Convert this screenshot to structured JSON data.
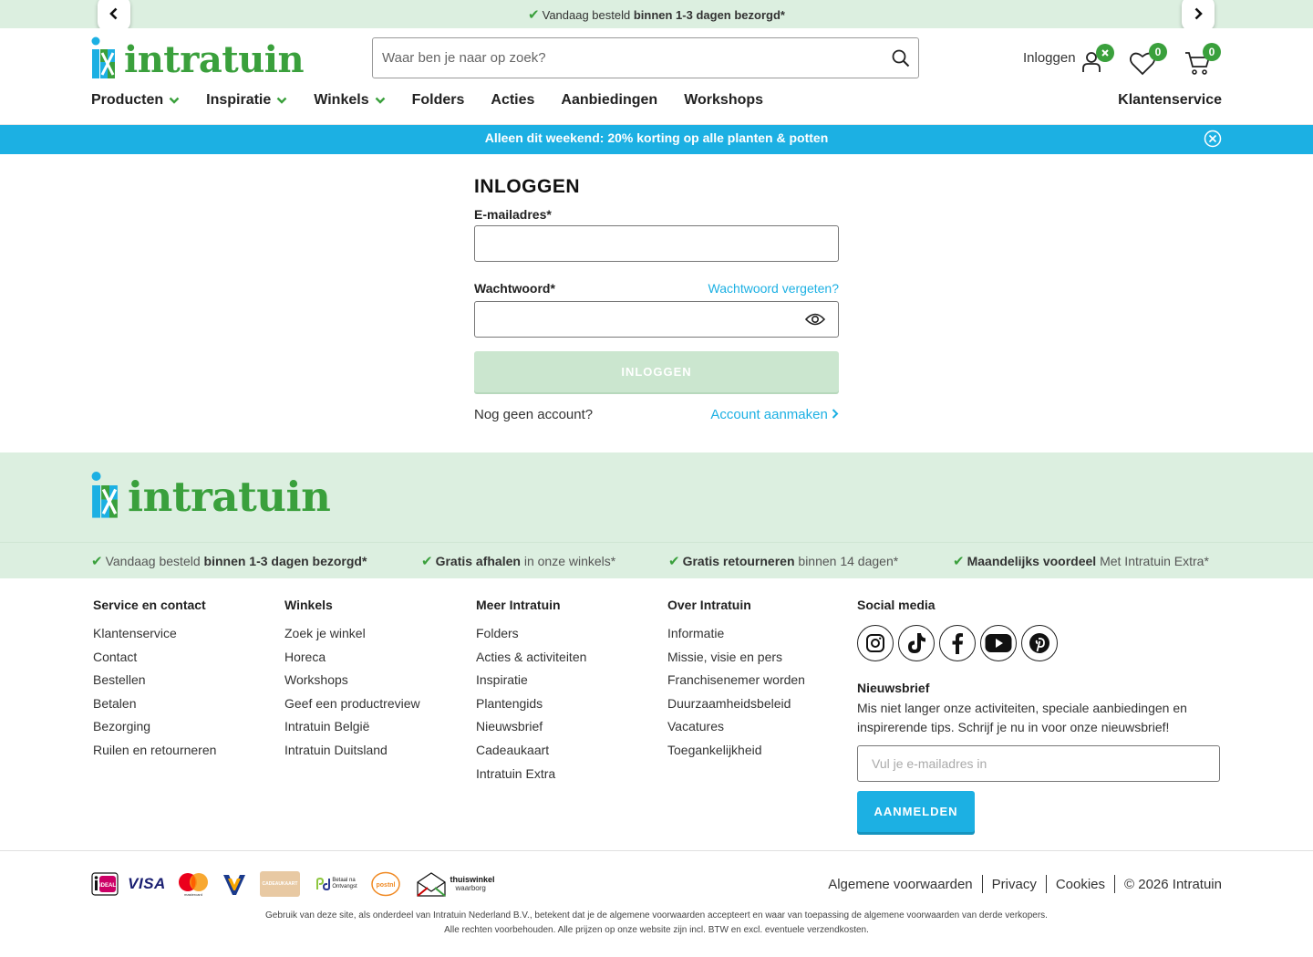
{
  "topbar": {
    "msg_pre": "Vandaag besteld ",
    "msg_bold": "binnen 1-3 dagen bezorgd*"
  },
  "header": {
    "logo_text": "intratuin",
    "search_placeholder": "Waar ben je naar op zoek?",
    "login_label": "Inloggen",
    "wishlist_count": "0",
    "cart_count": "0"
  },
  "nav": {
    "items": [
      "Producten",
      "Inspiratie",
      "Winkels",
      "Folders",
      "Acties",
      "Aanbiedingen",
      "Workshops"
    ],
    "right": "Klantenservice"
  },
  "promo": {
    "text": "Alleen dit weekend: 20% korting op alle planten & potten"
  },
  "login": {
    "title": "INLOGGEN",
    "email_label": "E-mailadres*",
    "password_label": "Wachtwoord*",
    "forgot_link": "Wachtwoord vergeten?",
    "submit": "INLOGGEN",
    "no_account": "Nog geen account?",
    "create_account": "Account aanmaken"
  },
  "footer": {
    "logo_text": "intratuin",
    "usps": [
      {
        "bold": "binnen 1-3 dagen bezorgd*",
        "pre": "Vandaag besteld ",
        "post": ""
      },
      {
        "bold": "Gratis afhalen",
        "pre": "",
        "post": " in onze winkels*"
      },
      {
        "bold": "Gratis retourneren",
        "pre": "",
        "post": " binnen 14 dagen*"
      },
      {
        "bold": "Maandelijks voordeel",
        "pre": "",
        "post": " Met Intratuin Extra*"
      }
    ],
    "columns": [
      {
        "title": "Service en contact",
        "links": [
          "Klantenservice",
          "Contact",
          "Bestellen",
          "Betalen",
          "Bezorging",
          "Ruilen en retourneren"
        ]
      },
      {
        "title": "Winkels",
        "links": [
          "Zoek je winkel",
          "Horeca",
          "Workshops",
          "Geef een productreview",
          "Intratuin België",
          "Intratuin Duitsland"
        ]
      },
      {
        "title": "Meer Intratuin",
        "links": [
          "Folders",
          "Acties & activiteiten",
          "Inspiratie",
          "Plantengids",
          "Nieuwsbrief",
          "Cadeaukaart",
          "Intratuin Extra"
        ]
      },
      {
        "title": "Over Intratuin",
        "links": [
          "Informatie",
          "Missie, visie en pers",
          "Franchisenemer worden",
          "Duurzaamheidsbeleid",
          "Vacatures",
          "Toegankelijkheid"
        ]
      }
    ],
    "social_title": "Social media",
    "social": [
      "instagram-icon",
      "tiktok-icon",
      "facebook-icon",
      "youtube-icon",
      "pinterest-icon"
    ],
    "newsletter_title": "Nieuwsbrief",
    "newsletter_text": "Mis niet langer onze activiteiten, speciale aanbiedingen en inspirerende tips. Schrijf je nu in voor onze nieuwsbrief!",
    "newsletter_placeholder": "Vul je e-mailadres in",
    "newsletter_button": "AANMELDEN",
    "payment": {
      "ideal": "iDEAL",
      "visa": "VISA",
      "mastercard": "mastercard",
      "giftcard": "CADEAUKAART",
      "afterpay_1": "Betaal na",
      "afterpay_2": "Ontvangst",
      "postnl": "postnl",
      "thuiswinkel_1": "thuiswinkel",
      "thuiswinkel_2": "waarborg"
    },
    "legal_links": [
      "Algemene voorwaarden",
      "Privacy",
      "Cookies",
      "© 2026 Intratuin"
    ],
    "disclaimer_1": "Gebruik van deze site, als onderdeel van Intratuin Nederland B.V., betekent dat je de algemene voorwaarden accepteert en waar van toepassing de algemene voorwaarden van derde verkopers.",
    "disclaimer_2": "Alle rechten voorbehouden. Alle prijzen op onze website zijn incl. BTW en excl. eventuele verzendkosten."
  },
  "colors": {
    "brand_green": "#3aa03c",
    "light_green": "#dcefe0",
    "brand_blue": "#1cb0e3",
    "disabled_green": "#cbe6cf"
  }
}
